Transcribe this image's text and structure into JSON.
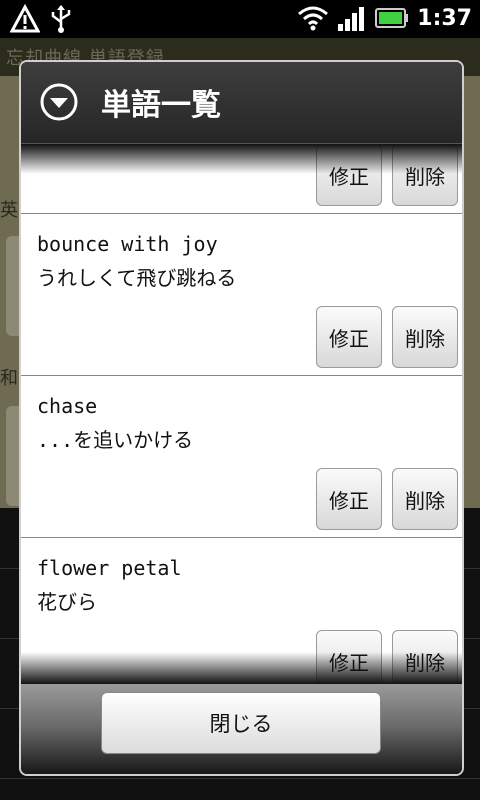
{
  "status_bar": {
    "time": "1:37",
    "icons": [
      "warning-icon",
      "usb-icon",
      "wifi-icon",
      "signal-icon",
      "battery-icon"
    ]
  },
  "background_app": {
    "title": "忘却曲線 単語登録",
    "label_english": "英",
    "label_japanese": "和"
  },
  "dialog": {
    "title": "単語一覧",
    "title_icon": "chevron-down-circle-icon",
    "close_label": "閉じる",
    "edit_label": "修正",
    "delete_label": "削除",
    "entries": [
      {
        "word": "",
        "meaning": ""
      },
      {
        "word": "bounce with joy",
        "meaning": "うれしくて飛び跳ねる"
      },
      {
        "word": "chase",
        "meaning": "...を追いかける"
      },
      {
        "word": "flower petal",
        "meaning": "花びら"
      }
    ]
  },
  "colors": {
    "header_bg": "#333333",
    "list_bg": "#ffffff",
    "battery_green": "#3fd13f"
  }
}
